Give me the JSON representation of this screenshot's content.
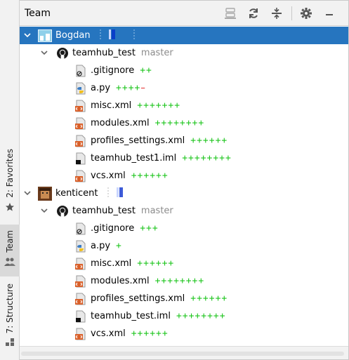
{
  "strip": {
    "favorites_label": "2: Favorites",
    "team_label": "Team",
    "structure_label": "7: Structure"
  },
  "panel": {
    "title": "Team",
    "toolbar": [
      "server-icon",
      "refresh-icon",
      "collapse-all-icon",
      "gear-icon",
      "minimize-icon"
    ]
  },
  "tree": [
    {
      "type": "user",
      "name": "Bogdan",
      "selected": true,
      "avatar": "bogdan-avatar",
      "rows": [
        {
          "type": "repo",
          "name": "teamhub_test",
          "branch": "master"
        },
        {
          "type": "file",
          "name": ".gitignore",
          "icon": "gitignore-file-icon",
          "added": "++",
          "removed": ""
        },
        {
          "type": "file",
          "name": "a.py",
          "icon": "python-file-icon",
          "added": "++++",
          "removed": "–"
        },
        {
          "type": "file",
          "name": "misc.xml",
          "icon": "xml-file-icon",
          "added": "+++++++",
          "removed": ""
        },
        {
          "type": "file",
          "name": "modules.xml",
          "icon": "xml-file-icon",
          "added": "++++++++",
          "removed": ""
        },
        {
          "type": "file",
          "name": "profiles_settings.xml",
          "icon": "xml-file-icon",
          "added": "++++++",
          "removed": ""
        },
        {
          "type": "file",
          "name": "teamhub_test1.iml",
          "icon": "iml-file-icon",
          "added": "++++++++",
          "removed": ""
        },
        {
          "type": "file",
          "name": "vcs.xml",
          "icon": "xml-file-icon",
          "added": "++++++",
          "removed": ""
        }
      ]
    },
    {
      "type": "user",
      "name": "kenticent",
      "selected": false,
      "avatar": "kenticent-avatar",
      "rows": [
        {
          "type": "repo",
          "name": "teamhub_test",
          "branch": "master"
        },
        {
          "type": "file",
          "name": ".gitignore",
          "icon": "gitignore-file-icon",
          "added": "+++",
          "removed": ""
        },
        {
          "type": "file",
          "name": "a.py",
          "icon": "python-file-icon",
          "added": "+",
          "removed": ""
        },
        {
          "type": "file",
          "name": "misc.xml",
          "icon": "xml-file-icon",
          "added": "++++++",
          "removed": ""
        },
        {
          "type": "file",
          "name": "modules.xml",
          "icon": "xml-file-icon",
          "added": "++++++++",
          "removed": ""
        },
        {
          "type": "file",
          "name": "profiles_settings.xml",
          "icon": "xml-file-icon",
          "added": "++++++",
          "removed": ""
        },
        {
          "type": "file",
          "name": "teamhub_test.iml",
          "icon": "iml-file-icon",
          "added": "++++++++",
          "removed": ""
        },
        {
          "type": "file",
          "name": "vcs.xml",
          "icon": "xml-file-icon",
          "added": "++++++",
          "removed": ""
        }
      ]
    }
  ],
  "colors": {
    "selection": "#2675bf",
    "added": "#1bc41b",
    "removed": "#e02020",
    "branch": "#8c8c8c"
  }
}
